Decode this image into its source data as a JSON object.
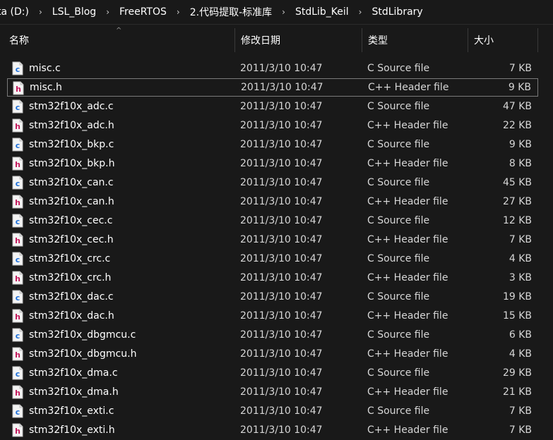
{
  "breadcrumb": [
    "ta (D:)",
    "LSL_Blog",
    "FreeRTOS",
    "2.代码提取-标准库",
    "StdLib_Keil",
    "StdLibrary"
  ],
  "columns": {
    "name": "名称",
    "date": "修改日期",
    "type": "类型",
    "size": "大小"
  },
  "colors": {
    "c_icon": "#1e6fd9",
    "h_icon": "#c2185b",
    "background": "#191919"
  },
  "files": [
    {
      "name": "misc.c",
      "date": "2011/3/10 10:47",
      "type": "C Source file",
      "size": "7 KB",
      "icon": "c-file-icon"
    },
    {
      "name": "misc.h",
      "date": "2011/3/10 10:47",
      "type": "C++ Header file",
      "size": "9 KB",
      "icon": "h-file-icon"
    },
    {
      "name": "stm32f10x_adc.c",
      "date": "2011/3/10 10:47",
      "type": "C Source file",
      "size": "47 KB",
      "icon": "c-file-icon"
    },
    {
      "name": "stm32f10x_adc.h",
      "date": "2011/3/10 10:47",
      "type": "C++ Header file",
      "size": "22 KB",
      "icon": "h-file-icon"
    },
    {
      "name": "stm32f10x_bkp.c",
      "date": "2011/3/10 10:47",
      "type": "C Source file",
      "size": "9 KB",
      "icon": "c-file-icon"
    },
    {
      "name": "stm32f10x_bkp.h",
      "date": "2011/3/10 10:47",
      "type": "C++ Header file",
      "size": "8 KB",
      "icon": "h-file-icon"
    },
    {
      "name": "stm32f10x_can.c",
      "date": "2011/3/10 10:47",
      "type": "C Source file",
      "size": "45 KB",
      "icon": "c-file-icon"
    },
    {
      "name": "stm32f10x_can.h",
      "date": "2011/3/10 10:47",
      "type": "C++ Header file",
      "size": "27 KB",
      "icon": "h-file-icon"
    },
    {
      "name": "stm32f10x_cec.c",
      "date": "2011/3/10 10:47",
      "type": "C Source file",
      "size": "12 KB",
      "icon": "c-file-icon"
    },
    {
      "name": "stm32f10x_cec.h",
      "date": "2011/3/10 10:47",
      "type": "C++ Header file",
      "size": "7 KB",
      "icon": "h-file-icon"
    },
    {
      "name": "stm32f10x_crc.c",
      "date": "2011/3/10 10:47",
      "type": "C Source file",
      "size": "4 KB",
      "icon": "c-file-icon"
    },
    {
      "name": "stm32f10x_crc.h",
      "date": "2011/3/10 10:47",
      "type": "C++ Header file",
      "size": "3 KB",
      "icon": "h-file-icon"
    },
    {
      "name": "stm32f10x_dac.c",
      "date": "2011/3/10 10:47",
      "type": "C Source file",
      "size": "19 KB",
      "icon": "c-file-icon"
    },
    {
      "name": "stm32f10x_dac.h",
      "date": "2011/3/10 10:47",
      "type": "C++ Header file",
      "size": "15 KB",
      "icon": "h-file-icon"
    },
    {
      "name": "stm32f10x_dbgmcu.c",
      "date": "2011/3/10 10:47",
      "type": "C Source file",
      "size": "6 KB",
      "icon": "c-file-icon"
    },
    {
      "name": "stm32f10x_dbgmcu.h",
      "date": "2011/3/10 10:47",
      "type": "C++ Header file",
      "size": "4 KB",
      "icon": "h-file-icon"
    },
    {
      "name": "stm32f10x_dma.c",
      "date": "2011/3/10 10:47",
      "type": "C Source file",
      "size": "29 KB",
      "icon": "c-file-icon"
    },
    {
      "name": "stm32f10x_dma.h",
      "date": "2011/3/10 10:47",
      "type": "C++ Header file",
      "size": "21 KB",
      "icon": "h-file-icon"
    },
    {
      "name": "stm32f10x_exti.c",
      "date": "2011/3/10 10:47",
      "type": "C Source file",
      "size": "7 KB",
      "icon": "c-file-icon"
    },
    {
      "name": "stm32f10x_exti.h",
      "date": "2011/3/10 10:47",
      "type": "C++ Header file",
      "size": "7 KB",
      "icon": "h-file-icon"
    }
  ]
}
